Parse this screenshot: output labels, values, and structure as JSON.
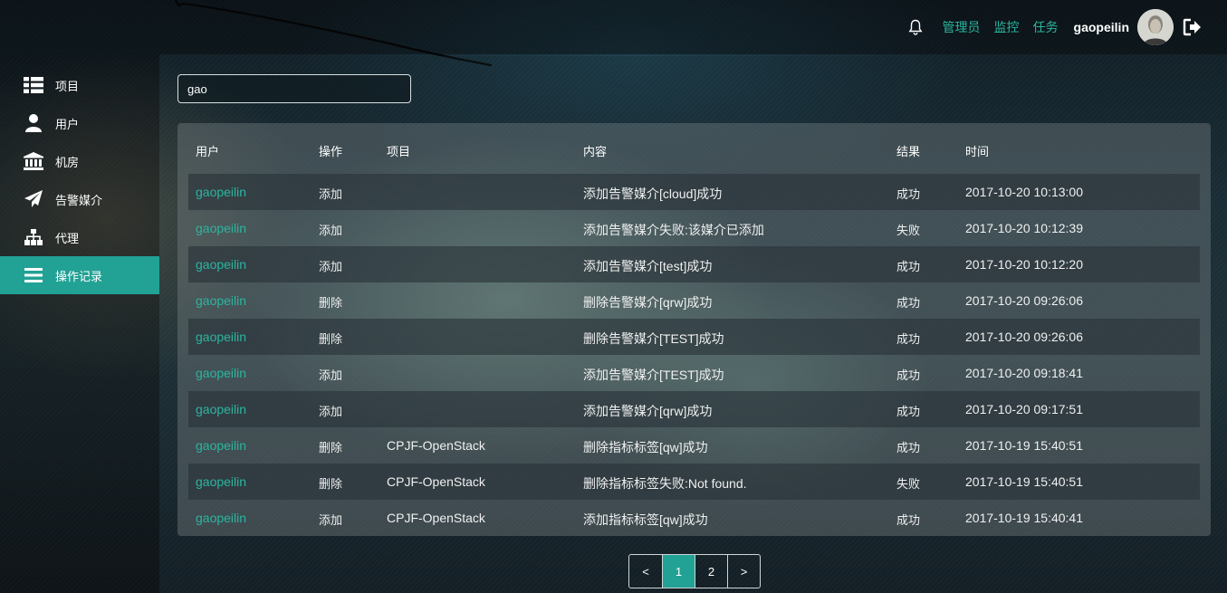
{
  "topbar": {
    "links": [
      "管理员",
      "监控",
      "任务"
    ],
    "username": "gaopeilin"
  },
  "sidebar": {
    "items": [
      {
        "label": "项目",
        "icon": "table-list-icon"
      },
      {
        "label": "用户",
        "icon": "user-icon"
      },
      {
        "label": "机房",
        "icon": "bank-icon"
      },
      {
        "label": "告警媒介",
        "icon": "paper-plane-icon"
      },
      {
        "label": "代理",
        "icon": "sitemap-icon"
      },
      {
        "label": "操作记录",
        "icon": "bars-icon",
        "active": true
      }
    ]
  },
  "search": {
    "value": "gao"
  },
  "table": {
    "columns": [
      "用户",
      "操作",
      "项目",
      "内容",
      "结果",
      "时间"
    ],
    "rows": [
      {
        "user": "gaopeilin",
        "op": "添加",
        "project": "",
        "content": "添加告警媒介[cloud]成功",
        "result": "成功",
        "time": "2017-10-20 10:13:00"
      },
      {
        "user": "gaopeilin",
        "op": "添加",
        "project": "",
        "content": "添加告警媒介失败:该媒介已添加",
        "result": "失败",
        "time": "2017-10-20 10:12:39"
      },
      {
        "user": "gaopeilin",
        "op": "添加",
        "project": "",
        "content": "添加告警媒介[test]成功",
        "result": "成功",
        "time": "2017-10-20 10:12:20"
      },
      {
        "user": "gaopeilin",
        "op": "删除",
        "project": "",
        "content": "删除告警媒介[qrw]成功",
        "result": "成功",
        "time": "2017-10-20 09:26:06"
      },
      {
        "user": "gaopeilin",
        "op": "删除",
        "project": "",
        "content": "删除告警媒介[TEST]成功",
        "result": "成功",
        "time": "2017-10-20 09:26:06"
      },
      {
        "user": "gaopeilin",
        "op": "添加",
        "project": "",
        "content": "添加告警媒介[TEST]成功",
        "result": "成功",
        "time": "2017-10-20 09:18:41"
      },
      {
        "user": "gaopeilin",
        "op": "添加",
        "project": "",
        "content": "添加告警媒介[qrw]成功",
        "result": "成功",
        "time": "2017-10-20 09:17:51"
      },
      {
        "user": "gaopeilin",
        "op": "删除",
        "project": "CPJF-OpenStack",
        "content": "删除指标标签[qw]成功",
        "result": "成功",
        "time": "2017-10-19 15:40:51"
      },
      {
        "user": "gaopeilin",
        "op": "删除",
        "project": "CPJF-OpenStack",
        "content": "删除指标标签失败:Not found.",
        "result": "失败",
        "time": "2017-10-19 15:40:51"
      },
      {
        "user": "gaopeilin",
        "op": "添加",
        "project": "CPJF-OpenStack",
        "content": "添加指标标签[qw]成功",
        "result": "成功",
        "time": "2017-10-19 15:40:41"
      }
    ]
  },
  "pagination": {
    "prev": "<",
    "pages": [
      "1",
      "2"
    ],
    "current": "1",
    "next": ">"
  }
}
